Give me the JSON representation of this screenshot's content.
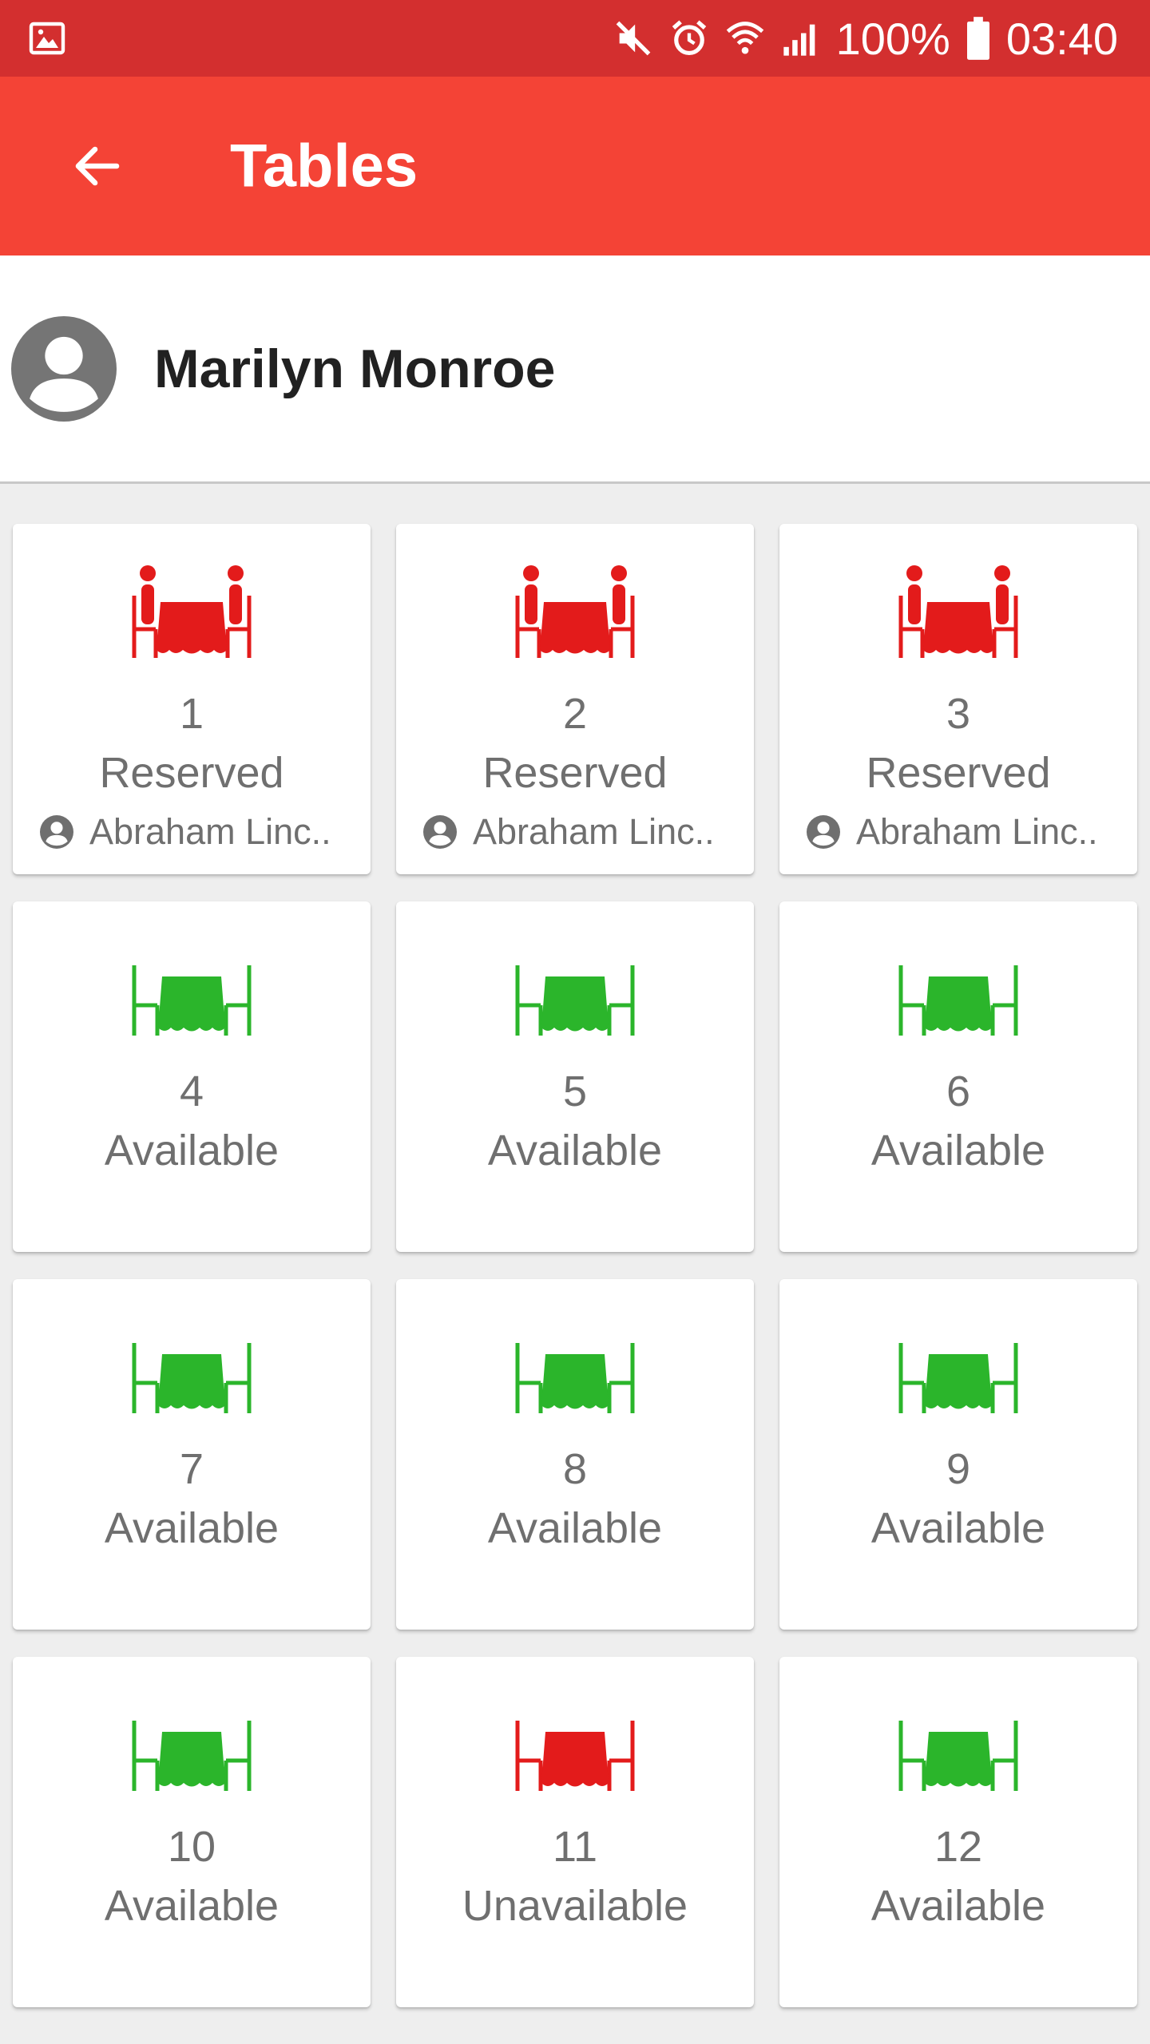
{
  "status_bar": {
    "battery": "100%",
    "time": "03:40",
    "icons": [
      "image-icon",
      "mute-icon",
      "alarm-icon",
      "wifi-icon",
      "signal-icon",
      "battery-icon"
    ]
  },
  "app_bar": {
    "title": "Tables",
    "back_icon": "arrow-back-icon",
    "color": "#f44336",
    "status_color": "#d32f2f"
  },
  "user": {
    "name": "Marilyn Monroe",
    "avatar_icon": "account-circle-icon"
  },
  "colors": {
    "reserved": "#e31b1b",
    "available": "#2bb52b",
    "unavailable": "#e31b1b"
  },
  "tables": [
    {
      "number": "1",
      "status": "Reserved",
      "guest": "Abraham Linc..",
      "icon": "table-with-people-icon",
      "color": "#e31b1b"
    },
    {
      "number": "2",
      "status": "Reserved",
      "guest": "Abraham Linc..",
      "icon": "table-with-people-icon",
      "color": "#e31b1b"
    },
    {
      "number": "3",
      "status": "Reserved",
      "guest": "Abraham Linc..",
      "icon": "table-with-people-icon",
      "color": "#e31b1b"
    },
    {
      "number": "4",
      "status": "Available",
      "icon": "table-icon",
      "color": "#2bb52b"
    },
    {
      "number": "5",
      "status": "Available",
      "icon": "table-icon",
      "color": "#2bb52b"
    },
    {
      "number": "6",
      "status": "Available",
      "icon": "table-icon",
      "color": "#2bb52b"
    },
    {
      "number": "7",
      "status": "Available",
      "icon": "table-icon",
      "color": "#2bb52b"
    },
    {
      "number": "8",
      "status": "Available",
      "icon": "table-icon",
      "color": "#2bb52b"
    },
    {
      "number": "9",
      "status": "Available",
      "icon": "table-icon",
      "color": "#2bb52b"
    },
    {
      "number": "10",
      "status": "Available",
      "icon": "table-icon",
      "color": "#2bb52b"
    },
    {
      "number": "11",
      "status": "Unavailable",
      "icon": "table-icon",
      "color": "#e31b1b"
    },
    {
      "number": "12",
      "status": "Available",
      "icon": "table-icon",
      "color": "#2bb52b"
    }
  ]
}
